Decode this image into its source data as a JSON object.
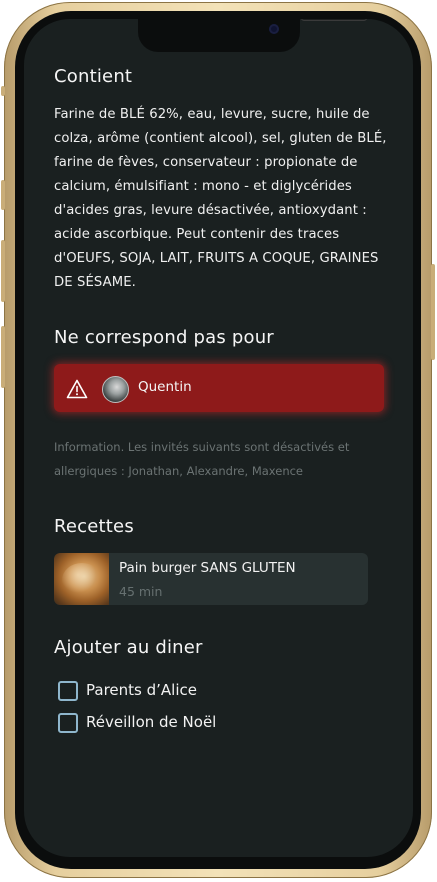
{
  "sections": {
    "contains_title": "Contient",
    "ingredients_text": "Farine de BLÉ 62%, eau, levure, sucre, huile de colza, arôme (contient alcool), sel, gluten de BLÉ, farine de fèves, conservateur : propionate de calcium, émulsifiant : mono - et diglycérides d'acides gras, levure désactivée, antioxydant : acide ascorbique. Peut contenir des traces d'OEUFS, SOJA, LAIT, FRUITS A COQUE, GRAINES DE SÉSAME.",
    "not_suitable_title": "Ne correspond pas pour",
    "recipes_title": "Recettes",
    "add_to_dinner_title": "Ajouter au diner"
  },
  "alert": {
    "icon": "warning-triangle-icon",
    "person_name": "Quentin",
    "color": "#8e1a1a"
  },
  "info_note": "Information. Les invités suivants sont désactivés et allergiques : Jonathan, Alexandre, Maxence",
  "recipes": [
    {
      "name": "Pain burger SANS GLUTEN",
      "time": "45 min"
    }
  ],
  "dinners": [
    {
      "label": "Parents d’Alice",
      "checked": false
    },
    {
      "label": "Réveillon de Noël",
      "checked": false
    }
  ]
}
